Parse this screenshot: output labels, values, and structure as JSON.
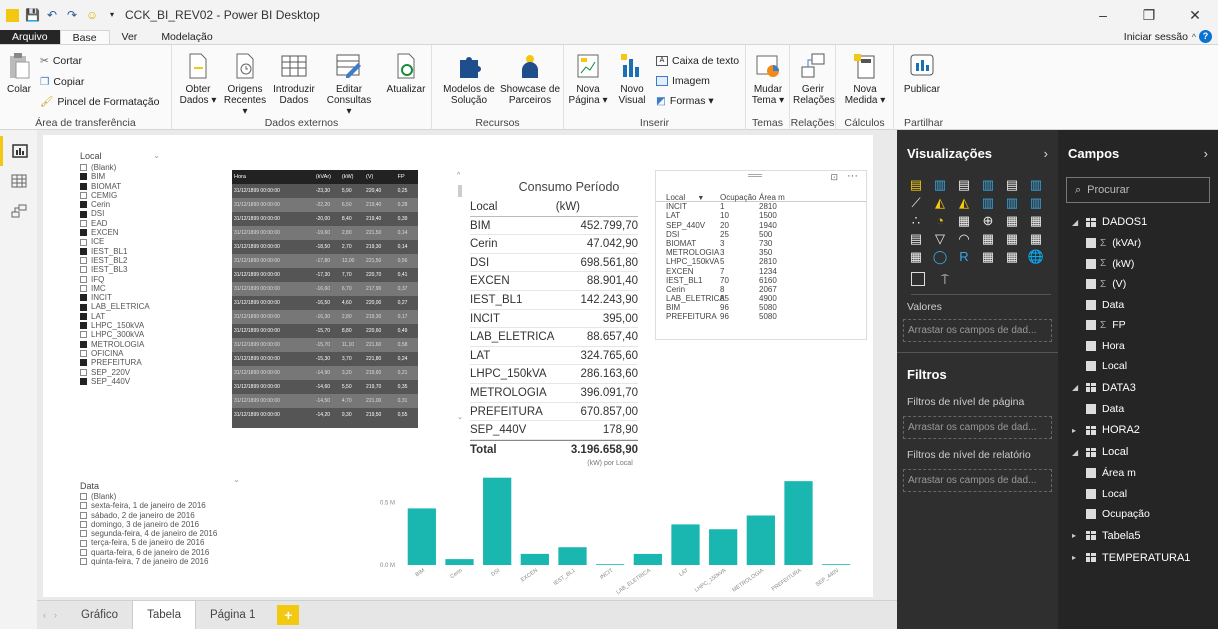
{
  "window": {
    "title": "CCK_BI_REV02 - Power BI Desktop",
    "minimize": "–",
    "restore": "❐",
    "close": "✕"
  },
  "menu": {
    "file": "Arquivo",
    "tabs": [
      "Base",
      "Ver",
      "Modelação"
    ],
    "signin": "Iniciar sessão",
    "help": "?"
  },
  "ribbon": {
    "clipboard": {
      "paste": "Colar",
      "cut": "Cortar",
      "copy": "Copiar",
      "format_painter": "Pincel de Formatação",
      "label": "Área de transferência"
    },
    "external": {
      "get_data": "Obter Dados ▾",
      "recent": "Origens Recentes ▾",
      "enter": "Introduzir Dados",
      "edit": "Editar Consultas ▾",
      "refresh": "Atualizar",
      "label": "Dados externos"
    },
    "resources": {
      "models": "Modelos de Solução",
      "showcase": "Showcase de Parceiros",
      "label": "Recursos"
    },
    "insert": {
      "new_page": "Nova Página ▾",
      "new_visual": "Novo Visual",
      "textbox": "Caixa de texto",
      "image": "Imagem",
      "shapes": "Formas ▾",
      "label": "Inserir"
    },
    "themes": {
      "switch": "Mudar Tema ▾",
      "label": "Temas"
    },
    "relations": {
      "manage": "Gerir Relações",
      "label": "Relações"
    },
    "calc": {
      "new_measure": "Nova Medida ▾",
      "label": "Cálculos"
    },
    "share": {
      "publish": "Publicar",
      "label": "Partilhar"
    }
  },
  "slicer_local": {
    "title": "Local",
    "items": [
      {
        "label": "(Blank)",
        "checked": false
      },
      {
        "label": "BIM",
        "checked": true
      },
      {
        "label": "BIOMAT",
        "checked": true
      },
      {
        "label": "CEMIG",
        "checked": false
      },
      {
        "label": "Cerin",
        "checked": true
      },
      {
        "label": "DSI",
        "checked": true
      },
      {
        "label": "EAD",
        "checked": false
      },
      {
        "label": "EXCEN",
        "checked": true
      },
      {
        "label": "ICE",
        "checked": false
      },
      {
        "label": "IEST_BL1",
        "checked": true
      },
      {
        "label": "IEST_BL2",
        "checked": false
      },
      {
        "label": "IEST_BL3",
        "checked": false
      },
      {
        "label": "IFQ",
        "checked": false
      },
      {
        "label": "IMC",
        "checked": false
      },
      {
        "label": "INCIT",
        "checked": true
      },
      {
        "label": "LAB_ELETRICA",
        "checked": true
      },
      {
        "label": "LAT",
        "checked": true
      },
      {
        "label": "LHPC_150kVA",
        "checked": true
      },
      {
        "label": "LHPC_300kVA",
        "checked": false
      },
      {
        "label": "METROLOGIA",
        "checked": true
      },
      {
        "label": "OFICINA",
        "checked": false
      },
      {
        "label": "PREFEITURA",
        "checked": true
      },
      {
        "label": "SEP_220V",
        "checked": false
      },
      {
        "label": "SEP_440V",
        "checked": true
      }
    ]
  },
  "slicer_data": {
    "title": "Data",
    "items": [
      "(Blank)",
      "sexta-feira, 1 de janeiro de 2016",
      "sábado, 2 de janeiro de 2016",
      "domingo, 3 de janeiro de 2016",
      "segunda-feira, 4 de janeiro de 2016",
      "terça-feira, 5 de janeiro de 2016",
      "quarta-feira, 6 de janeiro de 2016",
      "quinta-feira, 7 de janeiro de 2016"
    ]
  },
  "hour_table": {
    "headers": [
      "Hora",
      "(kVAr)",
      "(kW)",
      "(V)",
      "FP"
    ],
    "rows": [
      [
        "31/12/1899 00:00:00",
        "-23,30",
        "5,90",
        "220,40",
        "0,25"
      ],
      [
        "31/12/1899 00:00:00",
        "-22,20",
        "6,50",
        "219,40",
        "0,28"
      ],
      [
        "31/12/1899 00:00:00",
        "-20,00",
        "8,40",
        "219,40",
        "0,39"
      ],
      [
        "31/12/1899 00:00:00",
        "-19,60",
        "2,80",
        "221,50",
        "0,14"
      ],
      [
        "31/12/1899 00:00:00",
        "-18,50",
        "2,70",
        "219,30",
        "0,14"
      ],
      [
        "31/12/1899 00:00:00",
        "-17,80",
        "12,00",
        "221,50",
        "0,56"
      ],
      [
        "31/12/1899 00:00:00",
        "-17,30",
        "7,70",
        "220,70",
        "0,41"
      ],
      [
        "31/12/1899 00:00:00",
        "-16,60",
        "6,70",
        "217,90",
        "0,37"
      ],
      [
        "31/12/1899 00:00:00",
        "-16,50",
        "4,60",
        "220,00",
        "0,27"
      ],
      [
        "31/12/1899 00:00:00",
        "-16,30",
        "2,80",
        "219,30",
        "0,17"
      ],
      [
        "31/12/1899 00:00:00",
        "-15,70",
        "8,80",
        "220,60",
        "0,49"
      ],
      [
        "31/12/1899 00:00:00",
        "-15,70",
        "11,10",
        "221,60",
        "0,58"
      ],
      [
        "31/12/1899 00:00:00",
        "-15,30",
        "3,70",
        "221,80",
        "0,24"
      ],
      [
        "31/12/1899 00:00:00",
        "-14,90",
        "3,20",
        "219,60",
        "0,21"
      ],
      [
        "31/12/1899 00:00:00",
        "-14,60",
        "5,50",
        "219,70",
        "0,35"
      ],
      [
        "31/12/1899 00:00:00",
        "-14,50",
        "4,70",
        "221,00",
        "0,31"
      ],
      [
        "31/12/1899 00:00:00",
        "-14,20",
        "9,30",
        "219,50",
        "0,55"
      ]
    ]
  },
  "consumo": {
    "title": "Consumo Período",
    "col_local": "Local",
    "col_kw": "(kW)",
    "rows": [
      [
        "BIM",
        "452.799,70"
      ],
      [
        "Cerin",
        "47.042,90"
      ],
      [
        "DSI",
        "698.561,80"
      ],
      [
        "EXCEN",
        "88.901,40"
      ],
      [
        "IEST_BL1",
        "142.243,90"
      ],
      [
        "INCIT",
        "395,00"
      ],
      [
        "LAB_ELETRICA",
        "88.657,40"
      ],
      [
        "LAT",
        "324.765,60"
      ],
      [
        "LHPC_150kVA",
        "286.163,60"
      ],
      [
        "METROLOGIA",
        "396.091,70"
      ],
      [
        "PREFEITURA",
        "670.857,00"
      ],
      [
        "SEP_440V",
        "178,90"
      ]
    ],
    "total_label": "Total",
    "total_value": "3.196.658,90"
  },
  "ocupacao": {
    "headers": [
      "Local",
      "Ocupação",
      "Área m"
    ],
    "sort_icon": "▼",
    "more": "···",
    "rows": [
      [
        "INCIT",
        "1",
        "2810"
      ],
      [
        "LAT",
        "10",
        "1500"
      ],
      [
        "SEP_440V",
        "20",
        "1940"
      ],
      [
        "DSI",
        "25",
        "500"
      ],
      [
        "BIOMAT",
        "3",
        "730"
      ],
      [
        "METROLOGIA",
        "3",
        "350"
      ],
      [
        "LHPC_150kVA",
        "5",
        "2810"
      ],
      [
        "EXCEN",
        "7",
        "1234"
      ],
      [
        "IEST_BL1",
        "70",
        "6160"
      ],
      [
        "Cerin",
        "8",
        "2067"
      ],
      [
        "LAB_ELETRICA",
        "85",
        "4900"
      ],
      [
        "BIM",
        "96",
        "5080"
      ],
      [
        "PREFEITURA",
        "96",
        "5080"
      ]
    ]
  },
  "chart_data": {
    "type": "bar",
    "title": "(kW) por Local",
    "categories": [
      "BIM",
      "Cerin",
      "DSI",
      "EXCEN",
      "IEST_BL1",
      "INCIT",
      "LAB_ELETRICA",
      "LAT",
      "LHPC_150kVA",
      "METROLOGIA",
      "PREFEITURA",
      "SEP_440V"
    ],
    "values": [
      452799.7,
      47042.9,
      698561.8,
      88901.4,
      142243.9,
      395.0,
      88657.4,
      324765.6,
      286163.6,
      396091.7,
      670857.0,
      178.9
    ],
    "yticks": [
      "0.0 M",
      "0.5 M"
    ],
    "ylim": [
      0,
      800000
    ],
    "color": "#1ab7b0",
    "grid": false
  },
  "pages": {
    "tabs": [
      "Gráfico",
      "Tabela",
      "Página 1"
    ],
    "selected": "Tabela",
    "add": "+"
  },
  "viz_pane": {
    "title": "Visualizações",
    "values_label": "Valores",
    "values_drop": "Arrastar os campos de dad...",
    "filters_title": "Filtros",
    "page_filters": "Filtros de nível de página",
    "page_drop": "Arrastar os campos de dad...",
    "report_filters": "Filtros de nível de relatório",
    "report_drop": "Arrastar os campos de dad..."
  },
  "fields_pane": {
    "title": "Campos",
    "search_placeholder": "Procurar",
    "dados1": {
      "name": "DADOS1",
      "fields": [
        {
          "label": "(kVAr)",
          "sigma": true
        },
        {
          "label": "(kW)",
          "sigma": true
        },
        {
          "label": "(V)",
          "sigma": true
        },
        {
          "label": "Data",
          "sigma": false
        },
        {
          "label": "FP",
          "sigma": true
        },
        {
          "label": "Hora",
          "sigma": false
        },
        {
          "label": "Local",
          "sigma": false
        }
      ]
    },
    "data3": {
      "name": "DATA3",
      "fields": [
        {
          "label": "Data",
          "sigma": false
        }
      ]
    },
    "hora2": {
      "name": "HORA2"
    },
    "local": {
      "name": "Local",
      "fields": [
        {
          "label": "Área m",
          "sigma": false
        },
        {
          "label": "Local",
          "sigma": false
        },
        {
          "label": "Ocupação",
          "sigma": false
        }
      ]
    },
    "tabela5": {
      "name": "Tabela5"
    },
    "temperatura1": {
      "name": "TEMPERATURA1"
    }
  }
}
